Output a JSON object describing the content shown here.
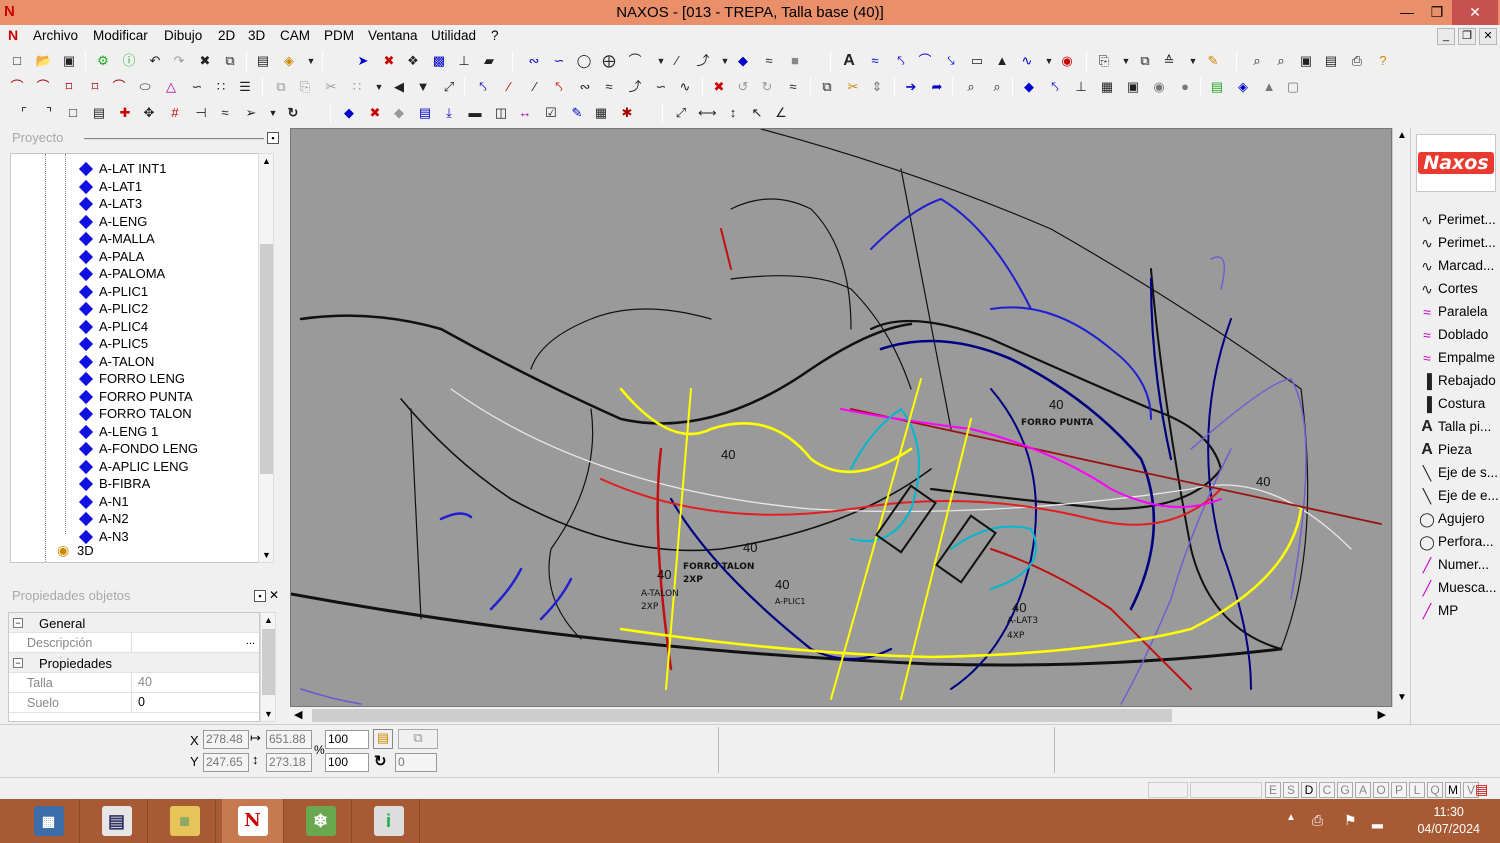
{
  "window": {
    "title": "NAXOS - [013 - TREPA, Talla base (40)]",
    "app_icon": "N"
  },
  "menu": [
    "Archivo",
    "Modificar",
    "Dibujo",
    "2D",
    "3D",
    "CAM",
    "PDM",
    "Ventana",
    "Utilidad",
    "?"
  ],
  "project_panel": {
    "title": "Proyecto",
    "items": [
      "A-LAT INT1",
      "A-LAT1",
      "A-LAT3",
      "A-LENG",
      "A-MALLA",
      "A-PALA",
      "A-PALOMA",
      "A-PLIC1",
      "A-PLIC2",
      "A-PLIC4",
      "A-PLIC5",
      "A-TALON",
      "FORRO LENG",
      "FORRO PUNTA",
      "FORRO TALON",
      "A-LENG 1",
      "A-FONDO LENG",
      "A-APLIC LENG",
      "B-FIBRA",
      "A-N1",
      "A-N2",
      "A-N3"
    ],
    "node_3d": "3D"
  },
  "props_panel": {
    "title": "Propiedades objetos",
    "cat_general": "General",
    "descripcion_label": "Descripción",
    "descripcion_btn": "...",
    "cat_props": "Propiedades",
    "talla_label": "Talla",
    "talla_value": "40",
    "suelo_label": "Suelo",
    "suelo_value": "0"
  },
  "canvas_labels": {
    "forro_punta": "FORRO PUNTA",
    "forro_talon": "FORRO TALON",
    "a_talon": "A-TALON",
    "a_lat3": "A-LAT3",
    "a_plic": "A-PLIC1",
    "qty_2xp": "2XP",
    "qty_4xp": "4XP",
    "size_40": "40"
  },
  "right_tools": [
    {
      "label": "Perimet...",
      "icon": "curve-icon"
    },
    {
      "label": "Perimet...",
      "icon": "curve-icon"
    },
    {
      "label": "Marcad...",
      "icon": "curve-icon"
    },
    {
      "label": "Cortes",
      "icon": "curve-icon"
    },
    {
      "label": "Paralela",
      "icon": "parallel-icon"
    },
    {
      "label": "Doblado",
      "icon": "fold-icon"
    },
    {
      "label": "Empalme",
      "icon": "joint-icon"
    },
    {
      "label": "Rebajado",
      "icon": "skive-icon"
    },
    {
      "label": "Costura",
      "icon": "stitch-icon"
    },
    {
      "label": "Talla pi...",
      "icon": "text-icon"
    },
    {
      "label": "Pieza",
      "icon": "text-icon"
    },
    {
      "label": "Eje de s...",
      "icon": "axis-icon"
    },
    {
      "label": "Eje de e...",
      "icon": "axis-icon"
    },
    {
      "label": "Agujero",
      "icon": "circle-icon"
    },
    {
      "label": "Perfora...",
      "icon": "circle-icon"
    },
    {
      "label": "Numer...",
      "icon": "pen-icon"
    },
    {
      "label": "Muesca...",
      "icon": "pen-icon"
    },
    {
      "label": "MP",
      "icon": "pen-icon"
    }
  ],
  "logo": "Naxos",
  "coords": {
    "x_label": "X",
    "y_label": "Y",
    "x": "278.48",
    "y": "247.65",
    "w": "651.88",
    "h": "273.18",
    "scale_x": "100",
    "scale_y": "100",
    "pct": "%",
    "angle": "0"
  },
  "status_flags": [
    "E",
    "S",
    "D",
    "C",
    "G",
    "A",
    "O",
    "P",
    "L",
    "Q",
    "M",
    "V"
  ],
  "clock": {
    "time": "11:30",
    "date": "04/07/2024"
  }
}
